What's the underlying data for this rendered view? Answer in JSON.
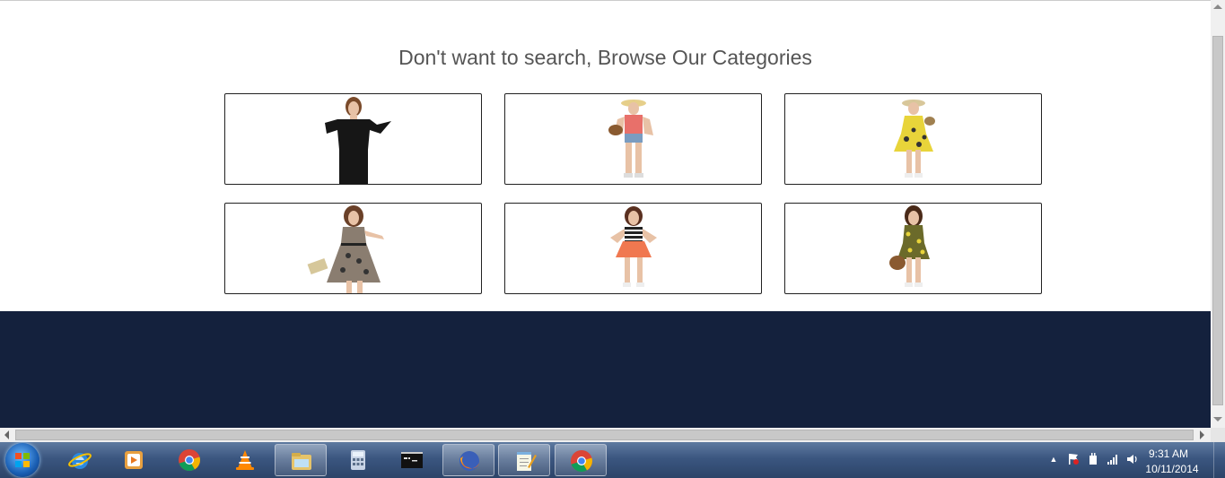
{
  "browse": {
    "heading": "Don't want to search, Browse Our Categories",
    "categories": [
      {
        "name": "black-outfit",
        "outfit_color": "#1a1a1a"
      },
      {
        "name": "denim-shorts",
        "outfit_color": "#e8706a"
      },
      {
        "name": "yellow-floral-dress",
        "outfit_color": "#e8d43a"
      },
      {
        "name": "leopard-print-dress",
        "outfit_color": "#8a7d70"
      },
      {
        "name": "orange-skirt",
        "outfit_color": "#f07850"
      },
      {
        "name": "olive-floral-dress",
        "outfit_color": "#6b6a2a"
      }
    ]
  },
  "colors": {
    "footer_bg": "#14213d",
    "taskbar": "#3b5680"
  },
  "taskbar": {
    "apps": [
      {
        "name": "internet-explorer-icon",
        "active": false
      },
      {
        "name": "media-player-icon",
        "active": false
      },
      {
        "name": "chrome-icon",
        "active": false
      },
      {
        "name": "vlc-icon",
        "active": false
      },
      {
        "name": "file-explorer-icon",
        "active": true
      },
      {
        "name": "calculator-icon",
        "active": false
      },
      {
        "name": "command-prompt-icon",
        "active": false
      },
      {
        "name": "firefox-icon",
        "active": true
      },
      {
        "name": "notepad-icon",
        "active": true
      },
      {
        "name": "chrome-icon",
        "active": true
      }
    ],
    "tray": {
      "time": "9:31 AM",
      "date": "10/11/2014"
    }
  }
}
